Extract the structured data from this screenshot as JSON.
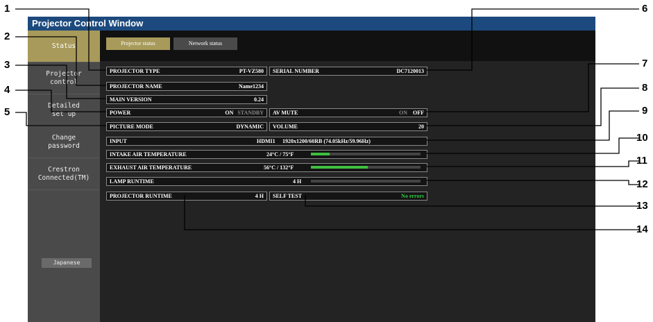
{
  "window": {
    "title": "Projector Control Window"
  },
  "sidebar": {
    "items": [
      {
        "label": "Status"
      },
      {
        "label": "Projector control"
      },
      {
        "label": "Detailed set up"
      },
      {
        "label": "Change password"
      },
      {
        "label": "Crestron Connected(TM)"
      }
    ],
    "language_button": "Japanese"
  },
  "tabs": [
    {
      "label": "Projector status"
    },
    {
      "label": "Network status"
    }
  ],
  "status": {
    "projector_type": {
      "label": "PROJECTOR TYPE",
      "value": "PT-VZ580"
    },
    "serial_number": {
      "label": "SERIAL NUMBER",
      "value": "DC7120013"
    },
    "projector_name": {
      "label": "PROJECTOR NAME",
      "value": "Name1234"
    },
    "main_version": {
      "label": "MAIN VERSION",
      "value": "0.24"
    },
    "power": {
      "label": "POWER",
      "on": "ON",
      "standby": "STANDBY"
    },
    "av_mute": {
      "label": "AV MUTE",
      "on": "ON",
      "off": "OFF"
    },
    "picture_mode": {
      "label": "PICTURE MODE",
      "value": "DYNAMIC"
    },
    "volume": {
      "label": "VOLUME",
      "value": "20"
    },
    "input": {
      "label": "INPUT",
      "source": "HDMI1",
      "signal": "1920x1200/60RB (74.05kHz/59.96Hz)"
    },
    "intake_temp": {
      "label": "INTAKE AIR TEMPERATURE",
      "value": "24°C / 75°F",
      "level": 0.17
    },
    "exhaust_temp": {
      "label": "EXHAUST AIR TEMPERATURE",
      "value": "56°C / 132°F",
      "level": 0.52
    },
    "lamp_runtime": {
      "label": "LAMP RUNTIME",
      "value": "4 H",
      "level": 0.0
    },
    "projector_runtime": {
      "label": "PROJECTOR RUNTIME",
      "value": "4 H"
    },
    "self_test": {
      "label": "SELF TEST",
      "value": "No errors"
    }
  },
  "callouts": [
    "1",
    "2",
    "3",
    "4",
    "5",
    "6",
    "7",
    "8",
    "9",
    "10",
    "11",
    "12",
    "13",
    "14"
  ]
}
